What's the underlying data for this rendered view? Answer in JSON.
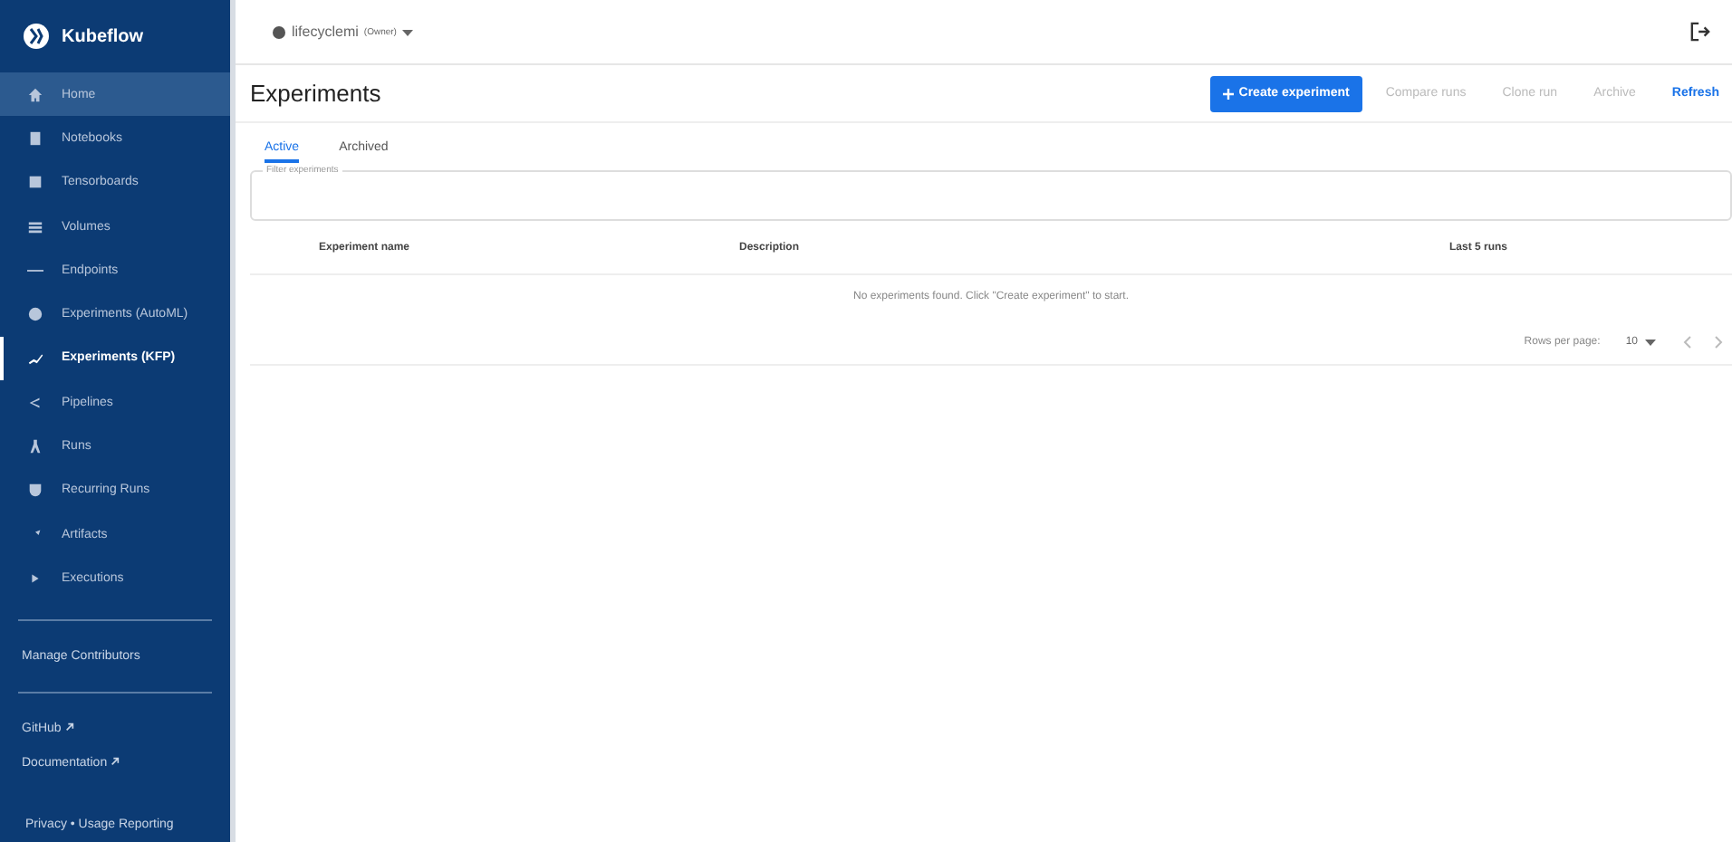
{
  "sidebar": {
    "brand": "Kubeflow",
    "items": [
      {
        "label": "Home",
        "selected": false,
        "highlighted": true
      },
      {
        "label": "Notebooks",
        "selected": false,
        "highlighted": false
      },
      {
        "label": "Tensorboards",
        "selected": false,
        "highlighted": false
      },
      {
        "label": "Volumes",
        "selected": false,
        "highlighted": false
      },
      {
        "label": "Endpoints",
        "selected": false,
        "highlighted": false
      },
      {
        "label": "Experiments (AutoML)",
        "selected": false,
        "highlighted": false
      },
      {
        "label": "Experiments (KFP)",
        "selected": true,
        "highlighted": false
      },
      {
        "label": "Pipelines",
        "selected": false,
        "highlighted": false
      },
      {
        "label": "Runs",
        "selected": false,
        "highlighted": false
      },
      {
        "label": "Recurring Runs",
        "selected": false,
        "highlighted": false
      },
      {
        "label": "Artifacts",
        "selected": false,
        "highlighted": false
      },
      {
        "label": "Executions",
        "selected": false,
        "highlighted": false
      }
    ],
    "manage": "Manage Contributors",
    "links": [
      "GitHub",
      "Documentation"
    ],
    "footer": "Privacy • Usage Reporting"
  },
  "namespace": {
    "name": "lifecyclemi",
    "role": "(Owner)"
  },
  "page": {
    "title": "Experiments",
    "actions": [
      {
        "label": "Create experiment",
        "kind": "primary"
      },
      {
        "label": "Compare runs",
        "kind": "disabled"
      },
      {
        "label": "Clone run",
        "kind": "disabled"
      },
      {
        "label": "Archive",
        "kind": "disabled"
      },
      {
        "label": "Refresh",
        "kind": "link"
      }
    ],
    "tabs": [
      {
        "label": "Active",
        "selected": true
      },
      {
        "label": "Archived",
        "selected": false
      }
    ],
    "filter": {
      "label": "Filter experiments"
    },
    "table": {
      "columns": [
        "Experiment name",
        "Description",
        "Last 5 runs"
      ],
      "empty": "No experiments found. Click \"Create experiment\" to start."
    },
    "pagination": {
      "label": "Rows per page:",
      "value": "10"
    }
  }
}
